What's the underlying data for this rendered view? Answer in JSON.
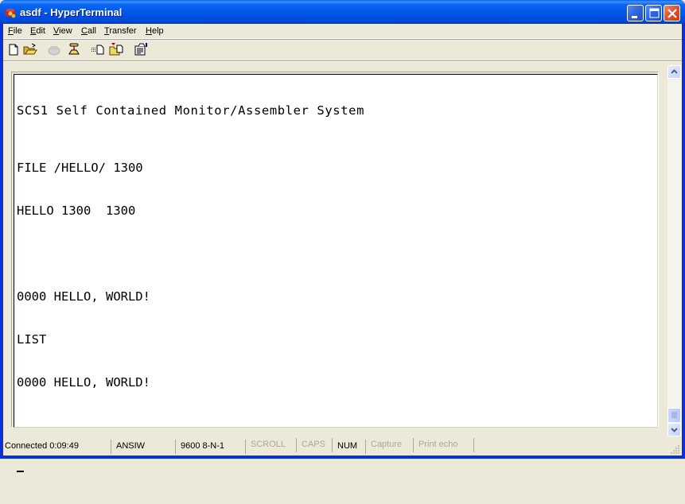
{
  "window": {
    "title": "asdf - HyperTerminal",
    "app_icon": "hyperterminal-phone-icon"
  },
  "titlebar_buttons": {
    "minimize": "minimize-icon",
    "maximize": "maximize-icon",
    "close": "close-icon"
  },
  "menu": {
    "items": [
      {
        "label": "File",
        "mnemonic": "F",
        "rest": "ile"
      },
      {
        "label": "Edit",
        "mnemonic": "E",
        "rest": "dit"
      },
      {
        "label": "View",
        "mnemonic": "V",
        "rest": "iew"
      },
      {
        "label": "Call",
        "mnemonic": "C",
        "rest": "all"
      },
      {
        "label": "Transfer",
        "mnemonic": "T",
        "rest": "ransfer"
      },
      {
        "label": "Help",
        "mnemonic": "H",
        "rest": "elp"
      }
    ]
  },
  "toolbar": {
    "buttons": [
      {
        "name": "new-connection",
        "icon": "new-document-icon",
        "enabled": true
      },
      {
        "name": "open",
        "icon": "open-folder-icon",
        "enabled": true
      },
      {
        "name": "call",
        "icon": "phone-icon",
        "enabled": false
      },
      {
        "name": "disconnect",
        "icon": "disconnect-phone-icon",
        "enabled": true
      },
      {
        "name": "send",
        "icon": "send-file-icon",
        "enabled": true
      },
      {
        "name": "receive",
        "icon": "receive-file-icon",
        "enabled": true
      },
      {
        "name": "properties",
        "icon": "properties-icon",
        "enabled": true
      }
    ]
  },
  "terminal": {
    "lines": [
      "SCS1 Self Contained Monitor/Assembler System",
      "FILE /HELLO/ 1300",
      "HELLO 1300  1300",
      "",
      "0000 HELLO, WORLD!",
      "LIST",
      "0000 HELLO, WORLD!",
      "",
      ""
    ]
  },
  "scrollbar": {
    "position": 1.0
  },
  "statusbar": {
    "connected": "Connected 0:09:49",
    "emulation": "ANSIW",
    "settings": "9600 8-N-1",
    "scroll": "SCROLL",
    "caps": "CAPS",
    "num": "NUM",
    "capture": "Capture",
    "print_echo": "Print echo"
  }
}
